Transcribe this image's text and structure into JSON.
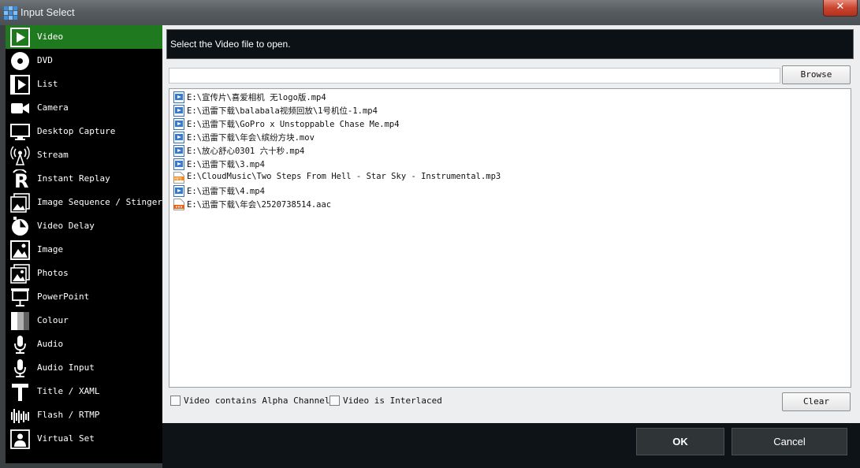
{
  "window": {
    "title": "Input Select",
    "close_glyph": "✕"
  },
  "sidebar": {
    "items": [
      {
        "label": "Video",
        "icon": "video-icon",
        "active": true
      },
      {
        "label": "DVD",
        "icon": "dvd-icon"
      },
      {
        "label": "List",
        "icon": "list-icon"
      },
      {
        "label": "Camera",
        "icon": "camera-icon"
      },
      {
        "label": "Desktop Capture",
        "icon": "desktop-capture-icon"
      },
      {
        "label": "Stream",
        "icon": "stream-icon"
      },
      {
        "label": "Instant Replay",
        "icon": "instant-replay-icon"
      },
      {
        "label": "Image Sequence / Stinger",
        "icon": "image-sequence-icon"
      },
      {
        "label": "Video Delay",
        "icon": "video-delay-icon"
      },
      {
        "label": "Image",
        "icon": "image-icon"
      },
      {
        "label": "Photos",
        "icon": "photos-icon"
      },
      {
        "label": "PowerPoint",
        "icon": "powerpoint-icon"
      },
      {
        "label": "Colour",
        "icon": "colour-icon"
      },
      {
        "label": "Audio",
        "icon": "audio-icon"
      },
      {
        "label": "Audio Input",
        "icon": "audio-input-icon"
      },
      {
        "label": "Title / XAML",
        "icon": "title-icon"
      },
      {
        "label": "Flash / RTMP",
        "icon": "flash-icon"
      },
      {
        "label": "Virtual Set",
        "icon": "virtual-set-icon"
      }
    ]
  },
  "main": {
    "header_text": "Select the Video file to open.",
    "path_value": "",
    "browse_label": "Browse",
    "clear_label": "Clear",
    "files": [
      {
        "name": "E:\\宣传片\\喜爱相机 无logo版.mp4",
        "type": "video"
      },
      {
        "name": "E:\\迅雷下载\\balabala视频回放\\1号机位-1.mp4",
        "type": "video"
      },
      {
        "name": "E:\\迅雷下载\\GoPro x Unstoppable Chase Me.mp4",
        "type": "video"
      },
      {
        "name": "E:\\迅雷下载\\年会\\缤纷方块.mov",
        "type": "video"
      },
      {
        "name": "E:\\放心舒心0301 六十秒.mp4",
        "type": "video"
      },
      {
        "name": "E:\\迅雷下载\\3.mp4",
        "type": "video"
      },
      {
        "name": "E:\\CloudMusic\\Two Steps From Hell - Star Sky - Instrumental.mp3",
        "type": "mp3"
      },
      {
        "name": "E:\\迅雷下载\\4.mp4",
        "type": "video"
      },
      {
        "name": "E:\\迅雷下载\\年会\\2520738514.aac",
        "type": "aac"
      }
    ],
    "options": [
      {
        "label": "Video contains Alpha Channel",
        "checked": false
      },
      {
        "label": "Video is Interlaced",
        "checked": false
      }
    ]
  },
  "footer": {
    "ok_label": "OK",
    "cancel_label": "Cancel"
  },
  "colors": {
    "active_item": "#1f7a1f",
    "sidebar_bg": "#000000",
    "header_bg": "#0b1114",
    "footer_bg": "#0d1316"
  }
}
